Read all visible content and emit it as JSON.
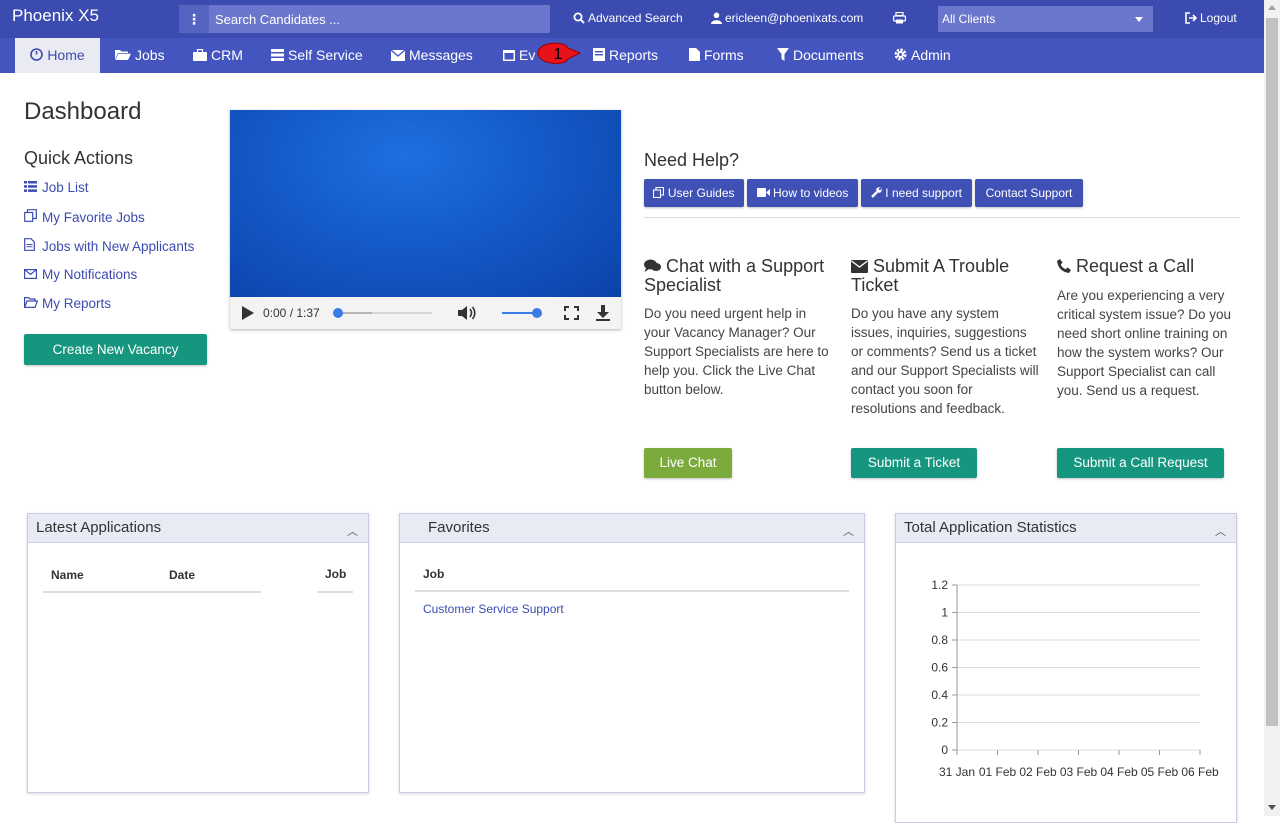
{
  "brand": "Phoenix X5",
  "search": {
    "placeholder": "Search Candidates ..."
  },
  "topbar": {
    "advanced_search": "Advanced Search",
    "user_email": "ericleen@phoenixats.com",
    "clients_selected": "All Clients",
    "logout": "Logout"
  },
  "nav": {
    "home": "Home",
    "jobs": "Jobs",
    "crm": "CRM",
    "self_service": "Self Service",
    "messages": "Messages",
    "events": "Ev",
    "reports": "Reports",
    "forms": "Forms",
    "documents": "Documents",
    "admin": "Admin"
  },
  "callout_number": "1",
  "dashboard": {
    "title": "Dashboard",
    "quick_actions_title": "Quick Actions",
    "quick_actions": [
      {
        "label": "Job List",
        "icon": "list-icon"
      },
      {
        "label": "My Favorite Jobs",
        "icon": "copy-icon"
      },
      {
        "label": "Jobs with New Applicants",
        "icon": "file-icon"
      },
      {
        "label": "My Notifications",
        "icon": "envelope-icon"
      },
      {
        "label": "My Reports",
        "icon": "folder-open-icon"
      }
    ],
    "create_vacancy": "Create New Vacancy"
  },
  "video": {
    "time": "0:00 / 1:37",
    "progress": 0,
    "volume": 0.85
  },
  "help": {
    "title": "Need Help?",
    "buttons": {
      "user_guides": "User Guides",
      "how_to_videos": "How to videos",
      "i_need_support": "I need support",
      "contact_support": "Contact Support"
    },
    "chat": {
      "title": "Chat with a Support Specialist",
      "text": "Do you need urgent help in your Vacancy Manager? Our Support Specialists are here to help you. Click the Live Chat button below.",
      "button": "Live Chat"
    },
    "ticket": {
      "title": "Submit A Trouble Ticket",
      "text": "Do you have any system issues, inquiries, suggestions or comments? Send us a ticket and our Support Specialists will contact you soon for resolutions and feedback.",
      "button": "Submit a Ticket"
    },
    "call": {
      "title": "Request a Call",
      "text": "Are you experiencing a very critical system issue? Do you need short online training on how the system works? Our Support Specialist can call you. Send us a request.",
      "button": "Submit a Call Request"
    }
  },
  "panels": {
    "latest": {
      "title": "Latest Applications",
      "col_name": "Name",
      "col_date": "Date",
      "col_job": "Job"
    },
    "favorites": {
      "title": "Favorites",
      "col_job": "Job",
      "rows": [
        "Customer Service Support"
      ]
    },
    "stats": {
      "title": "Total Application Statistics"
    }
  },
  "chart_data": {
    "type": "line",
    "title": "Total Application Statistics",
    "x": [
      "31 Jan",
      "01 Feb",
      "02 Feb",
      "03 Feb",
      "04 Feb",
      "05 Feb",
      "06 Feb"
    ],
    "series": [],
    "y_ticks": [
      "0",
      "0.2",
      "0.4",
      "0.6",
      "0.8",
      "1",
      "1.2"
    ],
    "ylim": [
      0,
      1.2
    ],
    "grid": true
  },
  "colors": {
    "brand": "#3c4bb0",
    "nav": "#4555c0",
    "teal": "#16967e",
    "green": "#7cab3d",
    "link": "#3c4bb0"
  }
}
